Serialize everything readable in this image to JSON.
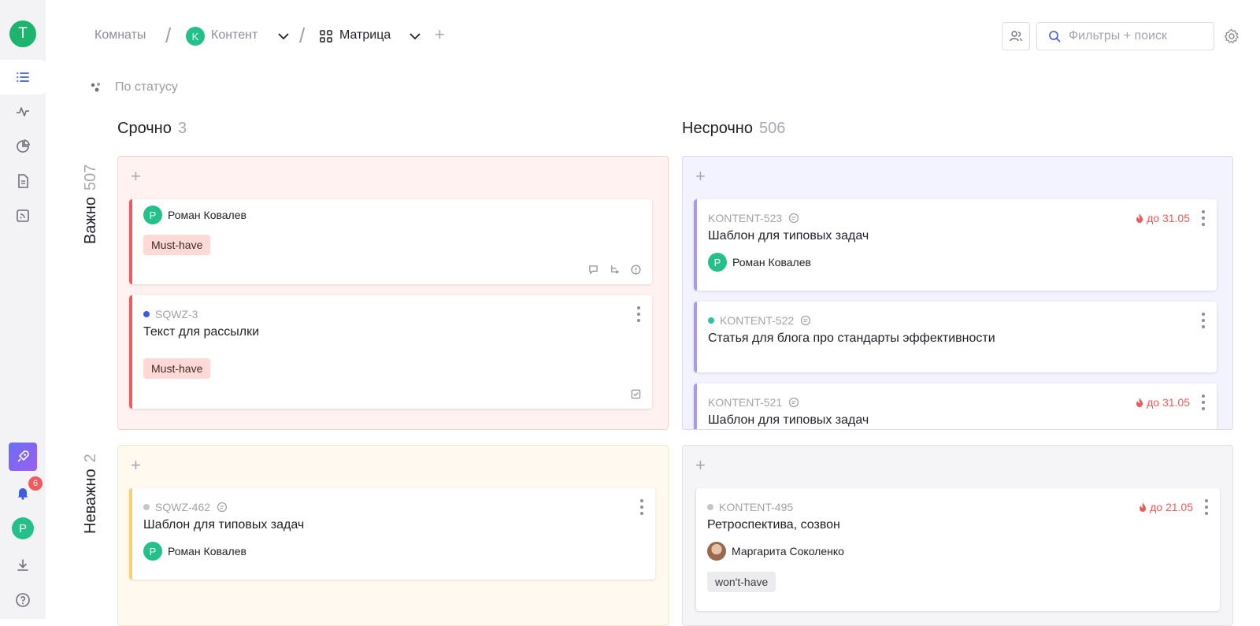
{
  "sidebar": {
    "workspace_initial": "T",
    "notifications_count": "6",
    "user_initial": "P"
  },
  "breadcrumb": {
    "rooms": "Комнаты",
    "space_initial": "K",
    "space": "Контент",
    "view": "Матрица"
  },
  "search": {
    "placeholder": "Фильтры + поиск"
  },
  "grouping": {
    "label": "По статусу"
  },
  "columns": [
    {
      "title": "Срочно",
      "count": "3"
    },
    {
      "title": "Несрочно",
      "count": "506"
    }
  ],
  "rows": [
    {
      "title": "Важно",
      "count": "507"
    },
    {
      "title": "Неважно",
      "count": "2"
    }
  ],
  "cards": {
    "q1_c1": {
      "assignee_initial": "P",
      "assignee": "Роман Ковалев",
      "tag": "Must-have"
    },
    "q1_c2": {
      "id": "SQWZ-3",
      "title": "Текст для рассылки",
      "tag": "Must-have"
    },
    "q2_c1": {
      "id": "KONTENT-523",
      "due": "до 31.05",
      "title": "Шаблон для типовых задач",
      "assignee_initial": "P",
      "assignee": "Роман Ковалев"
    },
    "q2_c2": {
      "id": "KONTENT-522",
      "title": "Статья для блога про стандарты эффективности"
    },
    "q2_c3": {
      "id": "KONTENT-521",
      "due": "до 31.05",
      "title": "Шаблон для типовых задач"
    },
    "q3_c1": {
      "id": "SQWZ-462",
      "title": "Шаблон для типовых задач",
      "assignee_initial": "P",
      "assignee": "Роман Ковалев"
    },
    "q4_c1": {
      "id": "KONTENT-495",
      "due": "до 21.05",
      "title": "Ретроспектива, созвон",
      "assignee": "Маргарита Соколенко",
      "tag": "won't-have"
    }
  },
  "colors": {
    "accent_green": "#25c08a",
    "urgent_red": "#ef5a5a",
    "purple": "#a79af0",
    "yellow": "#f5d26a",
    "status_blue": "#3b5ce4",
    "status_teal": "#2ec4a0",
    "status_gray": "#c4c5cc"
  }
}
